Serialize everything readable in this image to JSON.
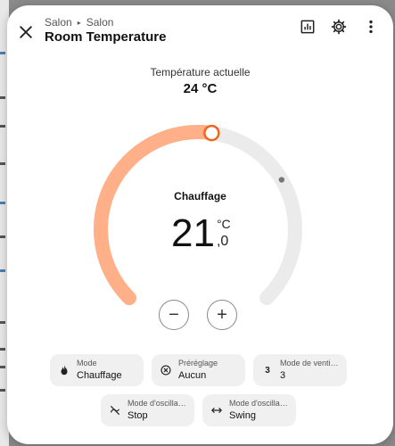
{
  "header": {
    "breadcrumb": [
      "Salon",
      "Salon"
    ],
    "title": "Room Temperature",
    "icons": [
      "close-icon",
      "history-chart-icon",
      "settings-gear-icon",
      "more-vertical-icon"
    ]
  },
  "current": {
    "label": "Température actuelle",
    "value": "24 °C"
  },
  "thermostat": {
    "mode_label": "Chauffage",
    "target_integer": "21",
    "target_unit": "°C",
    "target_decimal": ",0",
    "setpoint_fraction": 0.53,
    "current_fraction": 0.72,
    "active_color": "#ffb088",
    "track_color": "#ebebeb",
    "handle_color": "#f06420",
    "current_dot_color": "#777777"
  },
  "controls": {
    "decrease_symbol": "−",
    "increase_symbol": "+"
  },
  "chips": [
    {
      "label": "Mode",
      "value": "Chauffage",
      "icon": "flame-icon"
    },
    {
      "label": "Préréglage",
      "value": "Aucun",
      "icon": "preset-cancel-icon"
    },
    {
      "label": "Mode de venti…",
      "value": "3",
      "icon": "fan-speed-3-icon"
    },
    {
      "label": "Mode d'oscilla…",
      "value": "Stop",
      "icon": "swing-off-icon"
    },
    {
      "label": "Mode d'oscilla…",
      "value": "Swing",
      "icon": "swing-horizontal-icon"
    }
  ]
}
